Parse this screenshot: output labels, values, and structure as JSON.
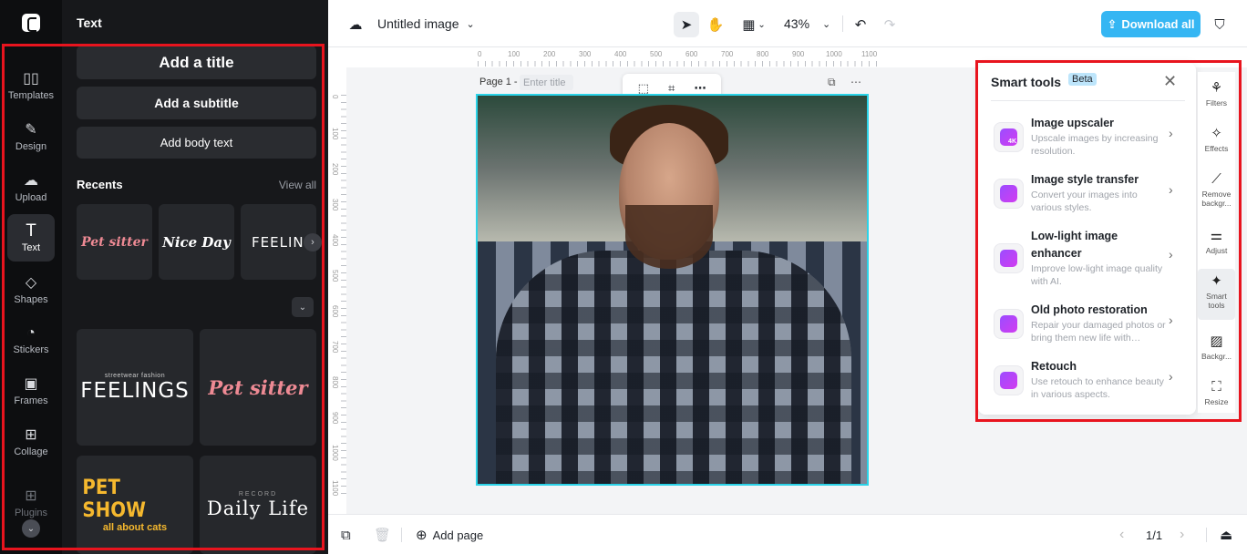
{
  "rail": {
    "items": [
      {
        "label": "Templates",
        "icon": "templates-icon",
        "glyph": "▯▯"
      },
      {
        "label": "Design",
        "icon": "design-icon",
        "glyph": "✎"
      },
      {
        "label": "Upload",
        "icon": "upload-icon",
        "glyph": "☁"
      },
      {
        "label": "Text",
        "icon": "text-icon",
        "glyph": "T"
      },
      {
        "label": "Shapes",
        "icon": "shapes-icon",
        "glyph": "◇"
      },
      {
        "label": "Stickers",
        "icon": "stickers-icon",
        "glyph": "◔"
      },
      {
        "label": "Frames",
        "icon": "frames-icon",
        "glyph": "▣"
      },
      {
        "label": "Collage",
        "icon": "collage-icon",
        "glyph": "⊞"
      },
      {
        "label": "Plugins",
        "icon": "plugins-icon",
        "glyph": "⊞"
      }
    ],
    "active_item": "Text"
  },
  "panel": {
    "title": "Text",
    "add_title": "Add a title",
    "add_subtitle": "Add a subtitle",
    "add_body": "Add body text",
    "recents_label": "Recents",
    "view_all": "View all",
    "recents": [
      {
        "text": "Pet sitter",
        "style": "script-pink"
      },
      {
        "text": "Nice Day",
        "style": "script-white"
      },
      {
        "text": "FEELINGS",
        "style": "feel"
      }
    ],
    "templates": [
      {
        "text": "FEELINGS",
        "sub": "streetwear fashion",
        "style": "feel"
      },
      {
        "text": "Pet sitter",
        "sub": "",
        "style": "script-pink"
      },
      {
        "text": "PET SHOW",
        "sub": "all about cats",
        "style": "petshow"
      },
      {
        "text": "Daily Life",
        "sub": "RECORD",
        "style": "daily"
      }
    ]
  },
  "topbar": {
    "doc_title": "Untitled image",
    "zoom": "43%",
    "download_label": "Download all"
  },
  "ruler": {
    "top": [
      "0",
      "100",
      "200",
      "300",
      "400",
      "500",
      "600",
      "700",
      "800",
      "900",
      "1000",
      "1100"
    ],
    "left": [
      "0",
      "100",
      "200",
      "300",
      "400",
      "500",
      "600",
      "700",
      "800",
      "900",
      "1000",
      "1100"
    ]
  },
  "canvas": {
    "page_label": "Page 1 -",
    "title_placeholder": "Enter title"
  },
  "smart_tools": {
    "title": "Smart tools",
    "badge": "Beta",
    "tools": [
      {
        "name": "Image upscaler",
        "desc": "Upscale images by increasing resolution.",
        "icon_text": "4K"
      },
      {
        "name": "Image style transfer",
        "desc": "Convert your images into various styles.",
        "icon_text": ""
      },
      {
        "name": "Low-light image enhancer",
        "desc": "Improve low-light image quality with AI.",
        "icon_text": ""
      },
      {
        "name": "Old photo restoration",
        "desc": "Repair your damaged photos or bring them new life with…",
        "icon_text": ""
      },
      {
        "name": "Retouch",
        "desc": "Use retouch to enhance beauty in various aspects.",
        "icon_text": ""
      }
    ]
  },
  "right_rail": {
    "items": [
      {
        "label": "Filters",
        "glyph": "⚘"
      },
      {
        "label": "Effects",
        "glyph": "✧"
      },
      {
        "label": "Remove backgr...",
        "glyph": "⟋"
      },
      {
        "label": "Adjust",
        "glyph": "⚌"
      },
      {
        "label": "Smart tools",
        "glyph": "✦"
      },
      {
        "label": "Backgr...",
        "glyph": "▨"
      },
      {
        "label": "Resize",
        "glyph": "⛶"
      }
    ],
    "active_item": "Smart tools"
  },
  "bottombar": {
    "add_page": "Add page",
    "page_count": "1/1"
  },
  "colors": {
    "accent": "#35b6f3",
    "annotation": "#e8141e",
    "selection": "#2bd3e8"
  }
}
